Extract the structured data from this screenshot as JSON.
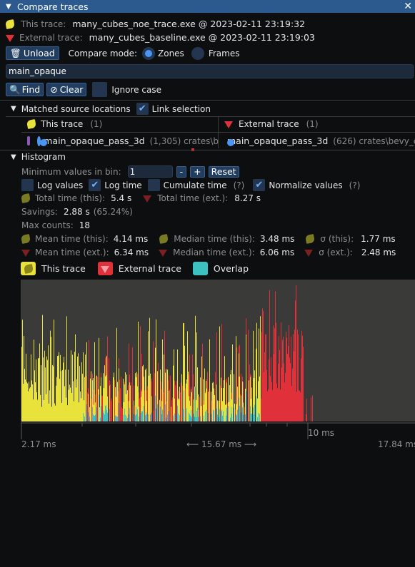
{
  "window": {
    "title": "Compare traces"
  },
  "traces": {
    "this_label": "This trace:",
    "this_value": "many_cubes_noe_trace.exe @ 2023-02-11 23:19:32",
    "ext_label": "External trace:",
    "ext_value": "many_cubes_baseline.exe @ 2023-02-11 23:19:03"
  },
  "toolbar": {
    "unload": "Unload",
    "compare_mode_label": "Compare mode:",
    "zones": "Zones",
    "frames": "Frames",
    "selected_mode": "Zones"
  },
  "search": {
    "value": "main_opaque",
    "find": "Find",
    "clear": "Clear",
    "ignore_case": "Ignore case",
    "ignore_case_checked": false
  },
  "matched": {
    "header": "Matched source locations",
    "link_selection": "Link selection",
    "link_selection_checked": true,
    "this_trace": "This trace",
    "this_count": "(1)",
    "ext_trace": "External trace",
    "ext_count": "(1)",
    "this_item_name": "main_opaque_pass_3d",
    "this_item_count": "(1,305) crates\\b",
    "ext_item_name": "main_opaque_pass_3d",
    "ext_item_count": "(626) crates\\bevy_c"
  },
  "histogram": {
    "header": "Histogram",
    "min_values_label": "Minimum values in bin:",
    "min_values": "1",
    "minus": "-",
    "plus": "+",
    "reset": "Reset",
    "log_values": "Log values",
    "log_values_checked": false,
    "log_time": "Log time",
    "log_time_checked": true,
    "cumulate_time": "Cumulate time",
    "cumulate_time_checked": false,
    "cumulate_help": "(?)",
    "normalize_values": "Normalize values",
    "normalize_checked": true,
    "normalize_help": "(?)",
    "total_this_label": "Total time (this):",
    "total_this": "5.4 s",
    "total_ext_label": "Total time (ext.):",
    "total_ext": "8.27 s",
    "savings_label": "Savings:",
    "savings": "2.88 s",
    "savings_pct": "(65.24%)",
    "max_counts_label": "Max counts:",
    "max_counts": "18",
    "mean_this_label": "Mean time (this):",
    "mean_this": "4.14 ms",
    "median_this_label": "Median time (this):",
    "median_this": "3.48 ms",
    "sigma_this_label": "σ (this):",
    "sigma_this": "1.77 ms",
    "mean_ext_label": "Mean time (ext.):",
    "mean_ext": "6.34 ms",
    "median_ext_label": "Median time (ext.):",
    "median_ext": "6.06 ms",
    "sigma_ext_label": "σ (ext.):",
    "sigma_ext": "2.48 ms",
    "legend_this": "This trace",
    "legend_ext": "External trace",
    "legend_overlap": "Overlap",
    "axis_left": "2.17 ms",
    "axis_mid": "15.67 ms",
    "axis_right": "17.84 ms",
    "axis_tick_label": "10 ms"
  },
  "colors": {
    "this": "#e8e23a",
    "ext": "#e0303a",
    "overlap": "#3cc0c0",
    "plot_bg": "#3a3a38"
  }
}
